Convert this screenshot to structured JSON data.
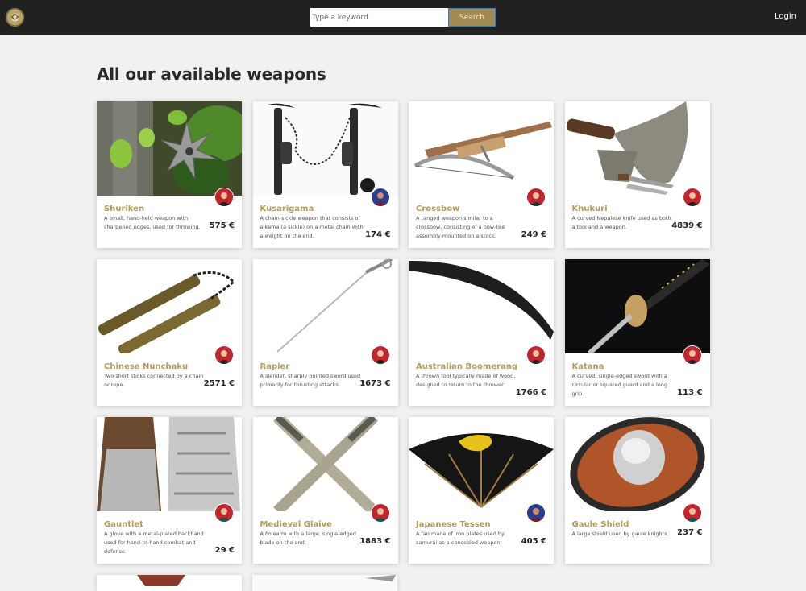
{
  "header": {
    "search_placeholder": "Type a keyword",
    "search_button": "Search",
    "login": "Login"
  },
  "page": {
    "title": "All our available weapons"
  },
  "weapons": [
    {
      "name": "Shuriken",
      "description": "A small, hand-held weapon with sharpened edges, used for throwing.",
      "price": "575 €"
    },
    {
      "name": "Kusarigama",
      "description": "A chain-sickle weapon that consists of a kama (a sickle) on a metal chain with a weight on the end.",
      "price": "174 €"
    },
    {
      "name": "Crossbow",
      "description": "A ranged weapon similar to a crossbow, consisting of a bow-like assembly mounted on a stock.",
      "price": "249 €"
    },
    {
      "name": "Khukuri",
      "description": "A curved Nepalese knife used as both a tool and a weapon.",
      "price": "4839 €"
    },
    {
      "name": "Chinese Nunchaku",
      "description": "Two short sticks connected by a chain or rope.",
      "price": "2571 €"
    },
    {
      "name": "Rapier",
      "description": "A slender, sharply pointed sword used primarily for thrusting attacks.",
      "price": "1673 €"
    },
    {
      "name": "Australian Boomerang",
      "description": "A thrown tool typically made of wood, designed to return to the thrower.",
      "price": "1766 €"
    },
    {
      "name": "Katana",
      "description": "A curved, single-edged sword with a circular or squared guard and a long grip.",
      "price": "113 €"
    },
    {
      "name": "Gauntlet",
      "description": "A glove with a metal-plated backhand used for hand-to-hand combat and defense.",
      "price": "29 €"
    },
    {
      "name": "Medieval Glaive",
      "description": "A Polearm with a large, single-edged blade on the end.",
      "price": "1883 €"
    },
    {
      "name": "Japanese Tessen",
      "description": "A fan made of iron plates used by samurai as a concealed weapon.",
      "price": "405 €"
    },
    {
      "name": "Gaule Shield",
      "description": "A large shield used by gaule knights.",
      "price": "237 €"
    }
  ],
  "colors": {
    "accent": "#b89a55",
    "header_bg": "#212121",
    "search_button_bg": "#a08a52"
  },
  "icons": {
    "logo": "emblem-logo-icon",
    "avatar": "seller-avatar-icon"
  }
}
